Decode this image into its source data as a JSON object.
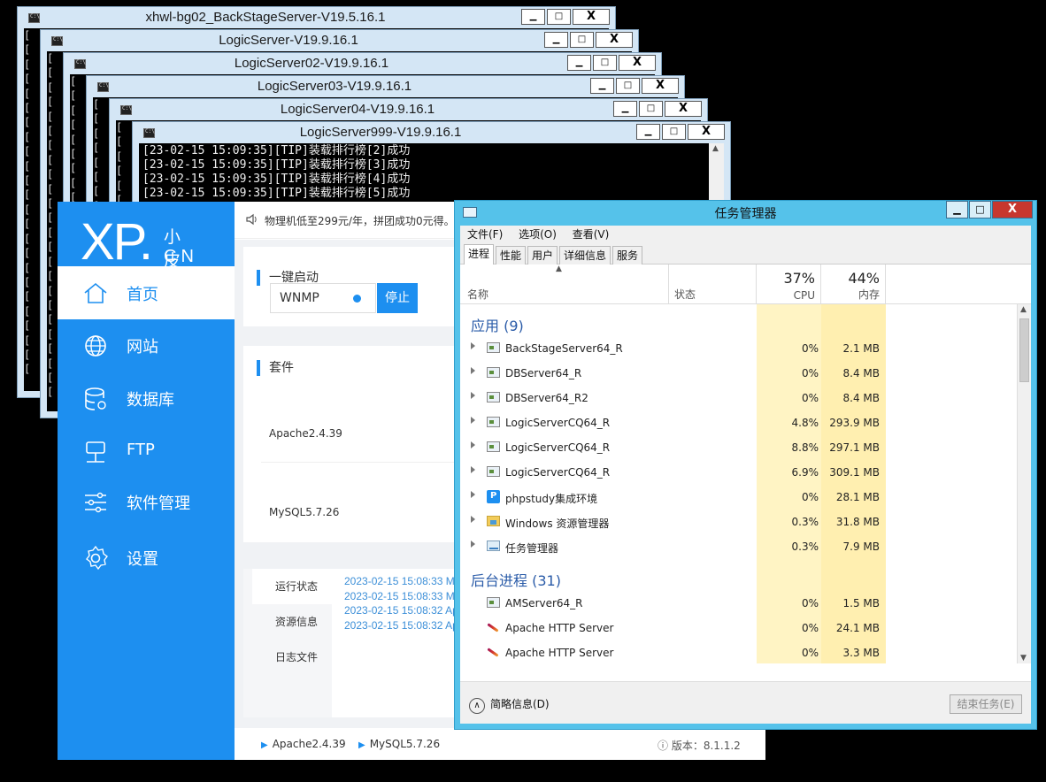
{
  "consoles": [
    {
      "title": "xhwl-bg02_BackStageServer-V19.5.16.1"
    },
    {
      "title": "LogicServer-V19.9.16.1"
    },
    {
      "title": "LogicServer02-V19.9.16.1"
    },
    {
      "title": "LogicServer03-V19.9.16.1"
    },
    {
      "title": "LogicServer04-V19.9.16.1"
    },
    {
      "title": "LogicServer999-V19.9.16.1",
      "lines": [
        "[23-02-15 15:09:35][TIP]装载排行榜[2]成功",
        "[23-02-15 15:09:35][TIP]装载排行榜[3]成功",
        "[23-02-15 15:09:35][TIP]装载排行榜[4]成功",
        "[23-02-15 15:09:35][TIP]装载排行榜[5]成功"
      ]
    }
  ],
  "window_buttons": {
    "minimize": "▁",
    "maximize": "□",
    "close": "X"
  },
  "phpstudy": {
    "logo_big": "XP.",
    "logo_small_top": "小皮",
    "logo_small_bottom": "CN",
    "nav": [
      "首页",
      "网站",
      "数据库",
      "FTP",
      "软件管理",
      "设置"
    ],
    "notice": "物理机低至299元/年，拼团成功0元得。",
    "quick_start_title": "一键启动",
    "quick_start_value": "WNMP",
    "stop_button": "停止",
    "suite_title": "套件",
    "suites": [
      "Apache2.4.39",
      "MySQL5.7.26"
    ],
    "tabs": [
      "运行状态",
      "资源信息",
      "日志文件"
    ],
    "log_lines": [
      "2023-02-15 15:08:33 M",
      "2023-02-15 15:08:33 M",
      "2023-02-15 15:08:32 Ap",
      "2023-02-15 15:08:32 Ap"
    ],
    "status_apache": "Apache2.4.39",
    "status_mysql": "MySQL5.7.26",
    "version": "ⓘ 版本：8.1.1.2"
  },
  "taskmgr": {
    "title": "任务管理器",
    "menu": [
      "文件(F)",
      "选项(O)",
      "查看(V)"
    ],
    "tabs": [
      "进程",
      "性能",
      "用户",
      "详细信息",
      "服务"
    ],
    "columns": {
      "name": "名称",
      "status": "状态",
      "cpu_pct": "37%",
      "cpu": "CPU",
      "mem_pct": "44%",
      "mem": "内存"
    },
    "apps_group": "应用 (9)",
    "apps": [
      {
        "name": "BackStageServer64_R",
        "cpu": "0%",
        "mem": "2.1 MB",
        "icon": "console-icon"
      },
      {
        "name": "DBServer64_R",
        "cpu": "0%",
        "mem": "8.4 MB",
        "icon": "console-icon"
      },
      {
        "name": "DBServer64_R2",
        "cpu": "0%",
        "mem": "8.4 MB",
        "icon": "console-icon"
      },
      {
        "name": "LogicServerCQ64_R",
        "cpu": "4.8%",
        "mem": "293.9 MB",
        "icon": "console-icon"
      },
      {
        "name": "LogicServerCQ64_R",
        "cpu": "8.8%",
        "mem": "297.1 MB",
        "icon": "console-icon"
      },
      {
        "name": "LogicServerCQ64_R",
        "cpu": "6.9%",
        "mem": "309.1 MB",
        "icon": "console-icon"
      },
      {
        "name": "phpstudy集成环境",
        "cpu": "0%",
        "mem": "28.1 MB",
        "icon": "phpstudy-icon"
      },
      {
        "name": "Windows 资源管理器",
        "cpu": "0.3%",
        "mem": "31.8 MB",
        "icon": "folder-icon"
      },
      {
        "name": "任务管理器",
        "cpu": "0.3%",
        "mem": "7.9 MB",
        "icon": "taskmgr-icon"
      }
    ],
    "bg_group": "后台进程 (31)",
    "bg": [
      {
        "name": "AMServer64_R",
        "cpu": "0%",
        "mem": "1.5 MB",
        "icon": "console-icon"
      },
      {
        "name": "Apache HTTP Server",
        "cpu": "0%",
        "mem": "24.1 MB",
        "icon": "apache-feather-icon"
      },
      {
        "name": "Apache HTTP Server",
        "cpu": "0%",
        "mem": "3.3 MB",
        "icon": "apache-feather-icon"
      }
    ],
    "fewer_details": "简略信息(D)",
    "end_task": "结束任务(E)"
  }
}
